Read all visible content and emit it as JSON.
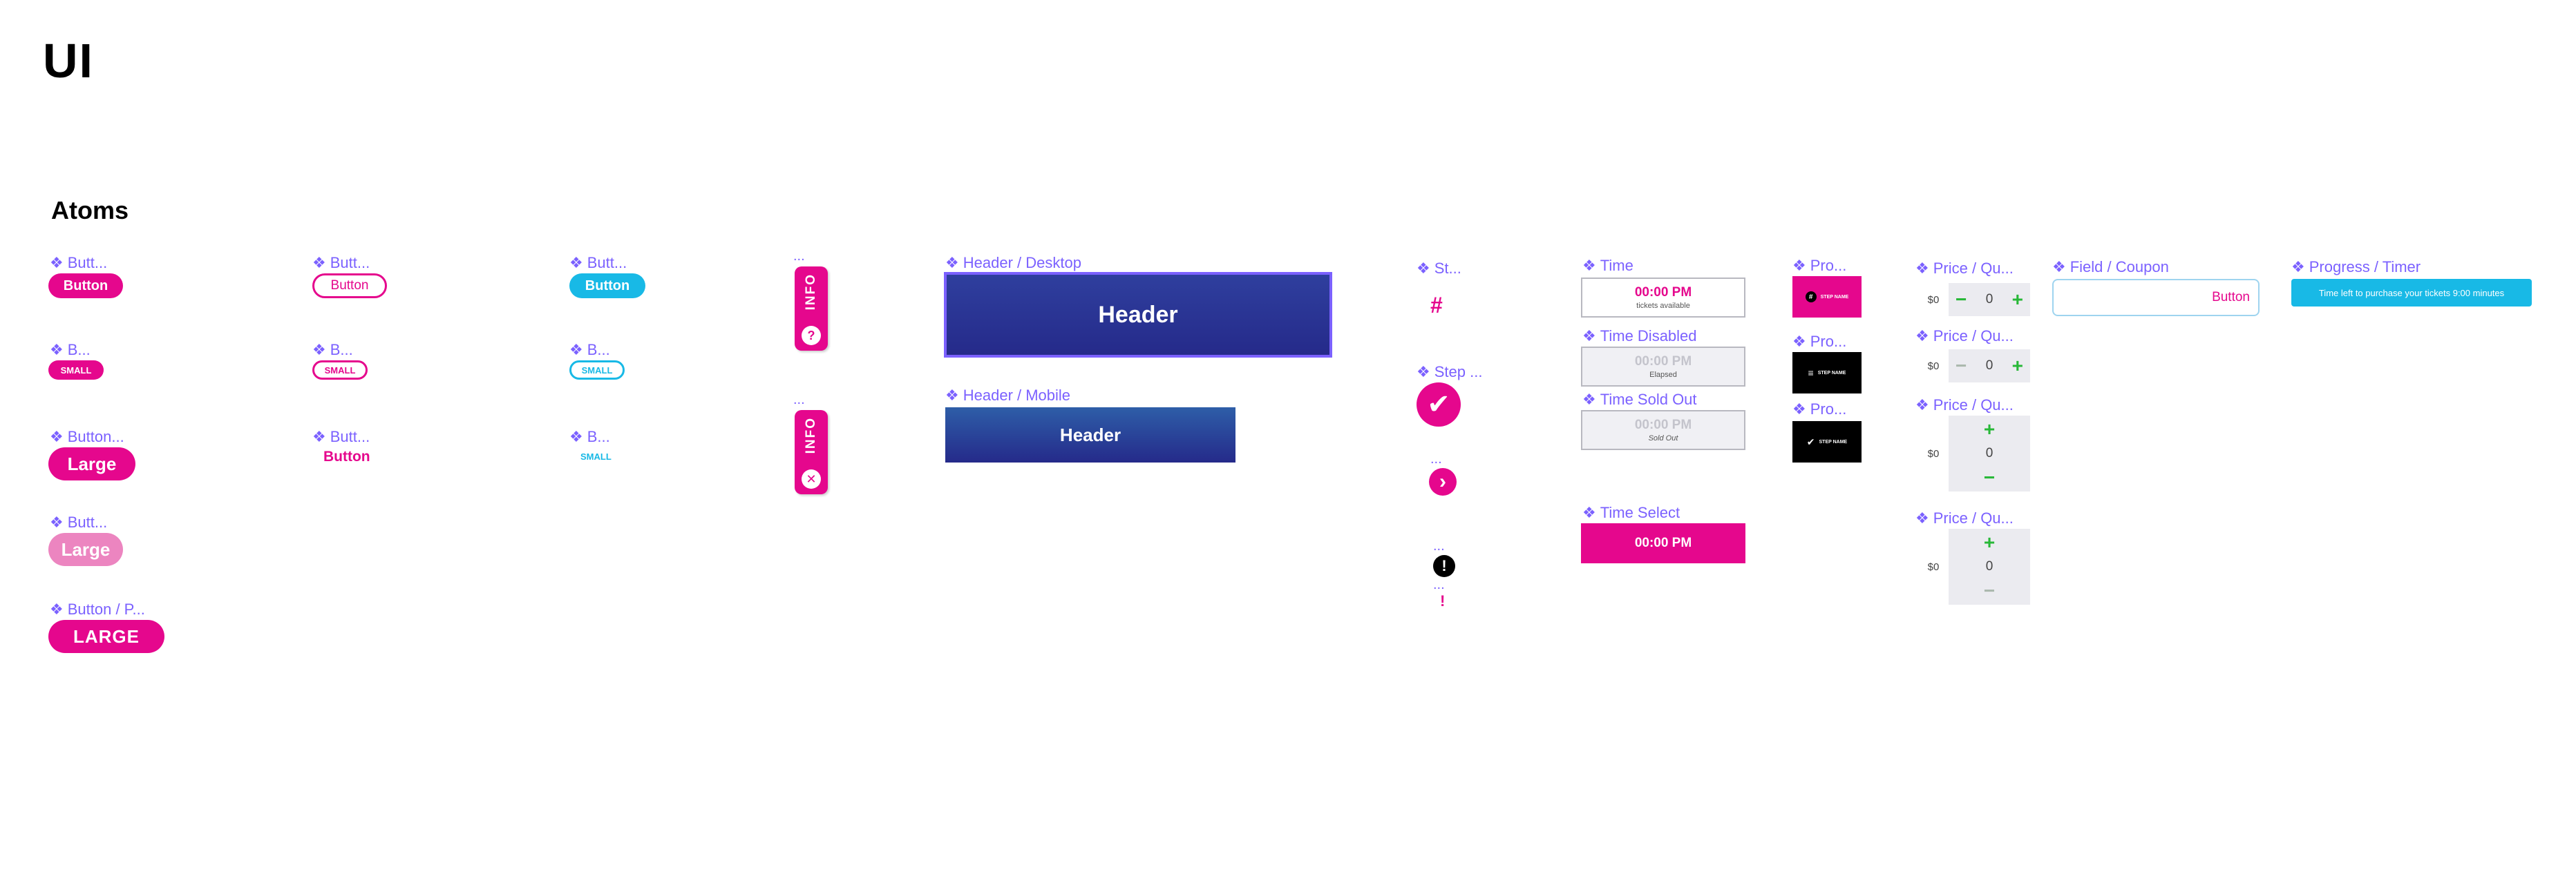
{
  "page": {
    "title": "UI",
    "section": "Atoms"
  },
  "colors": {
    "pink": "#e5078d",
    "cyan": "#18b9e6",
    "purple": "#7b61ff",
    "navy": "#2b2d8e",
    "green": "#28b838"
  },
  "labels": {
    "btn_pink": "Butt...",
    "btn_pink_outline": "Butt...",
    "btn_cyan": "Butt...",
    "small_pink": "B...",
    "small_pink_outline": "B...",
    "small_cyan": "B...",
    "large_pink": "Button...",
    "text_pink": "Butt...",
    "text_cyan": "B...",
    "large_light": "Butt...",
    "large_primary": "Button / P...",
    "info_1": "...",
    "info_2": "...",
    "header_desktop": "Header / Desktop",
    "header_mobile": "Header / Mobile",
    "step_num": "St...",
    "step_check": "Step ...",
    "step_arrow": "...",
    "step_alert": "...",
    "step_bang": "...",
    "time": "Time",
    "time_disabled": "Time Disabled",
    "time_sold_out": "Time Sold Out",
    "time_select": "Time Select",
    "pro_1": "Pro...",
    "pro_2": "Pro...",
    "pro_3": "Pro...",
    "price_1": "Price / Qu...",
    "price_2": "Price / Qu...",
    "price_3": "Price / Qu...",
    "price_4": "Price / Qu...",
    "field_coupon": "Field / Coupon",
    "progress_timer": "Progress / Timer"
  },
  "buttons": {
    "button": "Button",
    "button_outline": "Button",
    "button_cyan": "Button",
    "small": "SMALL",
    "small_outline": "SMALL",
    "small_cyan_outline": "SMALL",
    "large": "Large",
    "text_button": "Button",
    "small_text": "SMALL",
    "large_light": "Large",
    "large_caps": "LARGE"
  },
  "info_tab": {
    "text": "INFO",
    "icon_1": "?",
    "icon_2": "✕"
  },
  "headers": {
    "desktop": "Header",
    "mobile": "Header"
  },
  "steps": {
    "number": "#",
    "check": "✔",
    "arrow": "›",
    "alert": "!",
    "bang": "!"
  },
  "times": {
    "time": {
      "value": "00:00 PM",
      "sub": "tickets available"
    },
    "disabled": {
      "value": "00:00 PM",
      "sub": "Elapsed"
    },
    "sold_out": {
      "value": "00:00 PM",
      "sub": "Sold Out"
    },
    "select": {
      "value": "00:00 PM"
    }
  },
  "progress_steps": [
    {
      "icon": "#",
      "label": "STEP NAME"
    },
    {
      "icon": "≡",
      "label": "STEP NAME"
    },
    {
      "icon": "✔",
      "label": "STEP NAME"
    }
  ],
  "quantity": {
    "q1": {
      "price": "$0",
      "minus": "−",
      "value": "0",
      "plus": "+"
    },
    "q2": {
      "price": "$0",
      "minus": "−",
      "value": "0",
      "plus": "+"
    },
    "q3": {
      "price": "$0",
      "minus": "−",
      "value": "0",
      "plus": "+"
    },
    "q4": {
      "price": "$0",
      "minus": "−",
      "value": "0",
      "plus": "+"
    }
  },
  "coupon": {
    "button": "Button"
  },
  "timer": {
    "text": "Time left to purchase your tickets 9:00 minutes"
  }
}
